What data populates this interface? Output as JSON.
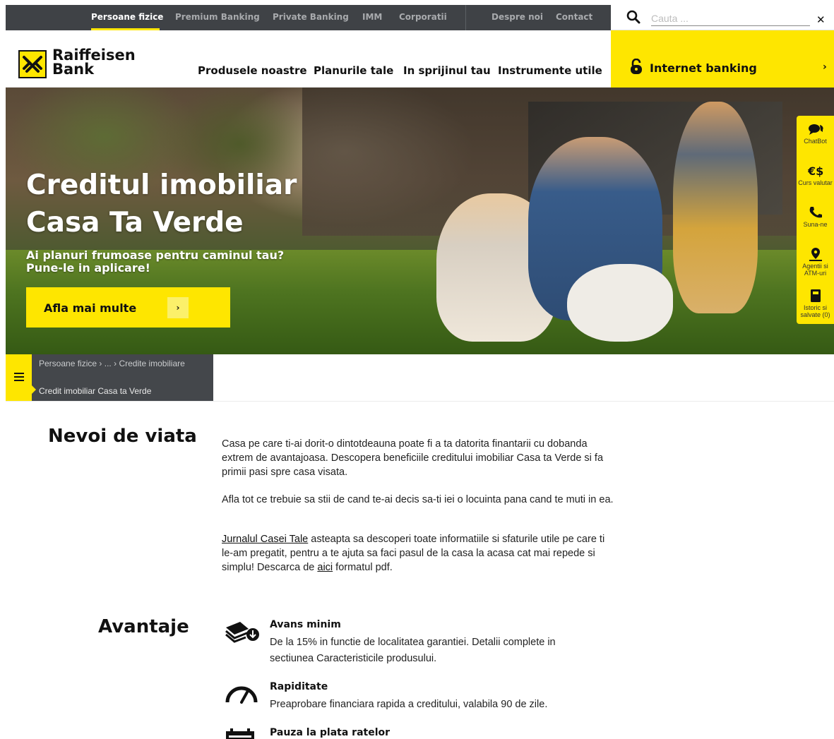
{
  "topbar": {
    "links": [
      "Persoane fizice",
      "Premium Banking",
      "Private Banking",
      "IMM",
      "Corporatii",
      "Despre noi",
      "Contact"
    ],
    "active": "Persoane fizice"
  },
  "search": {
    "placeholder": "Cauta ..."
  },
  "brand": {
    "line1": "Raiffeisen",
    "line2": "Bank"
  },
  "mainnav": [
    "Produsele noastre",
    "Planurile tale",
    "In sprijinul tau",
    "Instrumente utile"
  ],
  "internet_banking": {
    "label": "Internet banking"
  },
  "hero": {
    "title_line1": "Creditul imobiliar",
    "title_line2": "Casa Ta Verde",
    "subtitle_line1": "Ai planuri frumoase pentru caminul tau?",
    "subtitle_line2": "Pune-le in aplicare!",
    "cta": "Afla mai multe"
  },
  "sidetools": [
    {
      "label": "ChatBot",
      "icon": "chat-icon"
    },
    {
      "label": "Curs valutar",
      "icon": "currency-icon"
    },
    {
      "label": "Suna-ne",
      "icon": "phone-icon"
    },
    {
      "label": "Agentii si ATM-uri",
      "icon": "map-pin-icon"
    },
    {
      "label": "Istoric si salvate (0)",
      "icon": "bookmark-icon"
    }
  ],
  "breadcrumb": {
    "items": [
      "Persoane fizice",
      "...",
      "Credite imobiliare"
    ],
    "current": "Credit imobiliar Casa ta Verde"
  },
  "nevoi": {
    "title": "Nevoi de viata",
    "p1": "Casa pe care ti-ai dorit-o dintotdeauna poate fi a ta datorita finantarii cu dobanda extrem de avantajoasa. Descopera beneficiile creditului imobiliar Casa ta Verde si fa primii pasi spre casa visata.",
    "p2": "Afla tot ce trebuie sa stii de cand te-ai decis sa-ti iei o locuinta pana cand te muti in ea.",
    "p3_link": "Jurnalul Casei Tale",
    "p3_mid": " asteapta sa descoperi toate informatiile si sfaturile utile pe care ti le-am pregatit, pentru a te ajuta sa faci pasul de la casa la acasa cat mai repede si simplu! Descarca de ",
    "p3_link2": "aici",
    "p3_end": " formatul pdf."
  },
  "avantaje": {
    "title": "Avantaje",
    "items": [
      {
        "title": "Avans minim",
        "desc": "De la 15% in functie de localitatea garantiei. Detalii complete in sectiunea Caracteristicile produsului.",
        "icon": "money-stack-icon"
      },
      {
        "title": "Rapiditate",
        "desc": "Preaprobare financiara rapida a creditului, valabila 90 de zile.",
        "icon": "speedometer-icon"
      },
      {
        "title": "Pauza la plata ratelor",
        "desc": "",
        "icon": "calendar-icon"
      }
    ]
  },
  "colors": {
    "brand_yellow": "#fee600",
    "dark_bar": "#3f4246"
  }
}
